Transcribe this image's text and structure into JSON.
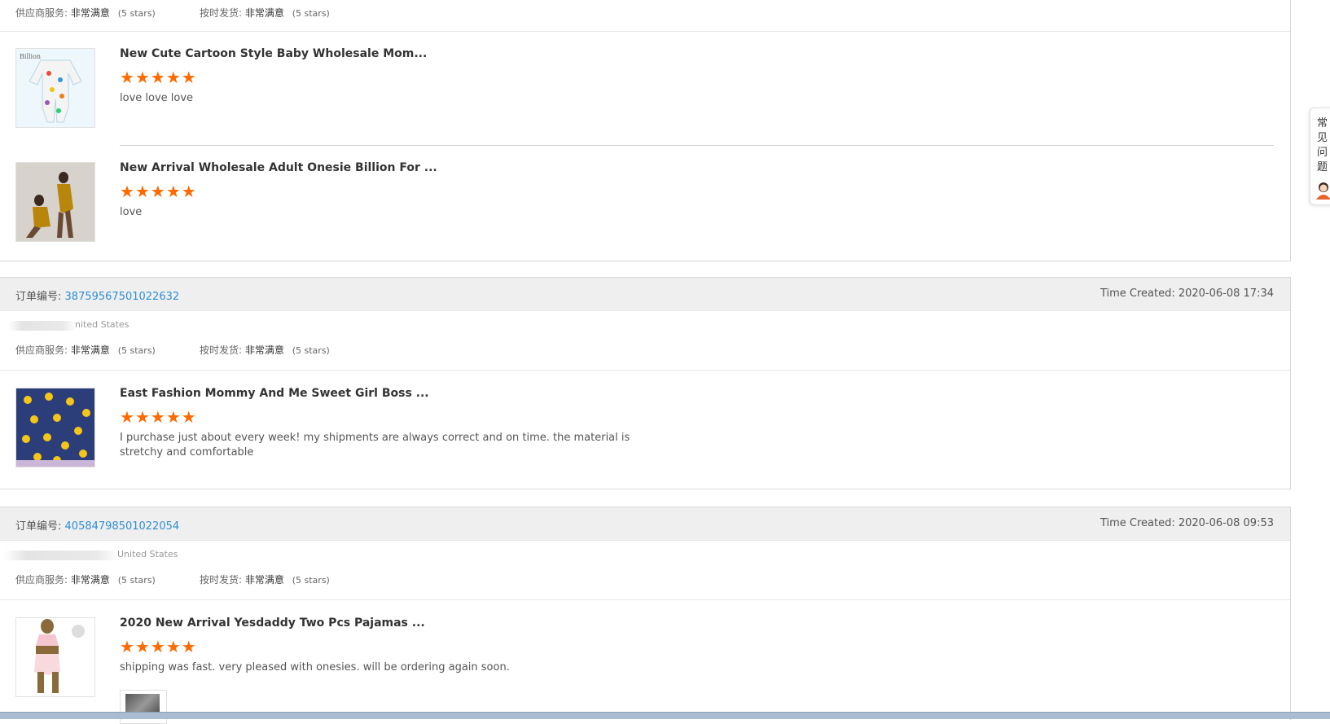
{
  "top_partial": {
    "ratings": {
      "supplier_label": "供应商服务:",
      "supplier_value": "非常满意",
      "supplier_stars": "(5 stars)",
      "ship_label": "按时发货:",
      "ship_value": "非常满意",
      "ship_stars": "(5 stars)"
    },
    "reviews": [
      {
        "title": "New Cute Cartoon Style Baby Wholesale Mom...",
        "rating": 5,
        "text": "love love love"
      },
      {
        "title": "New Arrival Wholesale Adult Onesie Billion For ...",
        "rating": 5,
        "text": "love"
      }
    ]
  },
  "orders": [
    {
      "order_label": "订单编号:",
      "order_no": "38759567501022632",
      "time_created": "Time Created: 2020-06-08 17:34",
      "country": "nited States",
      "ratings": {
        "supplier_label": "供应商服务:",
        "supplier_value": "非常满意",
        "supplier_stars": "(5 stars)",
        "ship_label": "按时发货:",
        "ship_value": "非常满意",
        "ship_stars": "(5 stars)"
      },
      "reviews": [
        {
          "title": "East Fashion Mommy And Me Sweet Girl Boss ...",
          "rating": 5,
          "text": "I purchase just about every week! my shipments are always correct and on time. the material is stretchy and comfortable"
        }
      ]
    },
    {
      "order_label": "订单编号:",
      "order_no": "40584798501022054",
      "time_created": "Time Created: 2020-06-08 09:53",
      "country": "United States",
      "ratings": {
        "supplier_label": "供应商服务:",
        "supplier_value": "非常满意",
        "supplier_stars": "(5 stars)",
        "ship_label": "按时发货:",
        "ship_value": "非常满意",
        "ship_stars": "(5 stars)"
      },
      "reviews": [
        {
          "title": "2020 New Arrival Yesdaddy Two Pcs Pajamas ...",
          "rating": 5,
          "text": "shipping was fast. very pleased with onesies. will be ordering again soon."
        }
      ]
    }
  ],
  "float_tab": {
    "label": "常见问题"
  },
  "icons": {
    "star": "star-icon",
    "avatar": "customer-service-avatar-icon"
  },
  "colors": {
    "link": "#2e8ed3",
    "star": "#ff6a00",
    "header_bg": "#efefef"
  }
}
